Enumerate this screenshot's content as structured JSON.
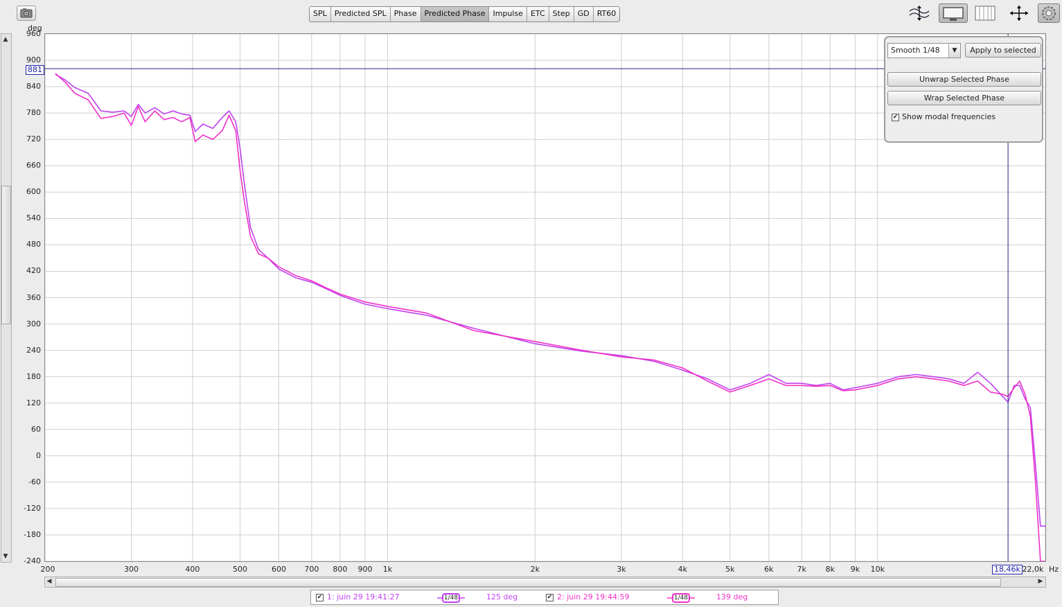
{
  "toolbar": {
    "tabs": [
      {
        "label": "SPL",
        "active": false
      },
      {
        "label": "Predicted SPL",
        "active": false
      },
      {
        "label": "Phase",
        "active": false
      },
      {
        "label": "Predicted Phase",
        "active": true
      },
      {
        "label": "Impulse",
        "active": false
      },
      {
        "label": "ETC",
        "active": false
      },
      {
        "label": "Step",
        "active": false
      },
      {
        "label": "GD",
        "active": false
      },
      {
        "label": "RT60",
        "active": false
      }
    ],
    "tools": [
      "vertical-zoom-icon",
      "limits-icon",
      "grid-lines-icon",
      "pan-icon",
      "settings-icon"
    ]
  },
  "panel": {
    "smoothing_value": "Smooth 1/48",
    "apply_label": "Apply to selected",
    "unwrap_label": "Unwrap Selected Phase",
    "wrap_label": "Wrap Selected Phase",
    "modal_label": "Show modal frequencies",
    "modal_checked": true
  },
  "cursor": {
    "y_value": "881",
    "x_value": "18,46k"
  },
  "legend": [
    {
      "checked": true,
      "name": "1: juin 29 19:41:27",
      "smoothing_num": "1",
      "smoothing_den": "48",
      "value": "125 deg",
      "color": "#c040f0"
    },
    {
      "checked": true,
      "name": "2: juin 29 19:44:59",
      "smoothing_num": "1",
      "smoothing_den": "48",
      "value": "139 deg",
      "color": "#f030c8"
    }
  ],
  "chart_data": {
    "type": "line",
    "y_unit": "deg",
    "x_unit": "Hz",
    "x_scale": "log",
    "xlim": [
      200,
      22000
    ],
    "ylim": [
      -240,
      960
    ],
    "x_ticks": [
      "200",
      "300",
      "400",
      "500",
      "600",
      "700",
      "800",
      "900",
      "1k",
      "2k",
      "3k",
      "4k",
      "5k",
      "6k",
      "7k",
      "8k",
      "9k",
      "10k",
      "22,0k"
    ],
    "y_ticks": [
      "960",
      "900",
      "840",
      "780",
      "720",
      "660",
      "600",
      "540",
      "480",
      "420",
      "360",
      "300",
      "240",
      "180",
      "120",
      "60",
      "0",
      "-60",
      "-120",
      "-180",
      "-240"
    ],
    "grid": true,
    "series": [
      {
        "name": "1: juin 29 19:41:27",
        "color": "#c040f0",
        "x": [
          210,
          220,
          230,
          245,
          260,
          275,
          290,
          300,
          310,
          320,
          335,
          350,
          365,
          380,
          395,
          405,
          420,
          440,
          460,
          475,
          490,
          500,
          510,
          525,
          545,
          570,
          600,
          650,
          700,
          750,
          800,
          900,
          1000,
          1200,
          1500,
          2000,
          2500,
          3000,
          3500,
          4000,
          4500,
          5000,
          5500,
          6000,
          6500,
          7000,
          7500,
          8000,
          8500,
          9000,
          10000,
          11000,
          12000,
          13000,
          14000,
          15000,
          16000,
          17000,
          18000,
          18460,
          19000,
          19500,
          20000,
          20500,
          21000,
          21500,
          22000
        ],
        "y": [
          868,
          855,
          838,
          825,
          785,
          782,
          785,
          772,
          800,
          780,
          792,
          778,
          785,
          778,
          775,
          738,
          755,
          745,
          770,
          785,
          760,
          700,
          620,
          520,
          470,
          450,
          425,
          405,
          395,
          380,
          365,
          345,
          335,
          320,
          290,
          255,
          238,
          228,
          215,
          195,
          175,
          150,
          165,
          185,
          165,
          165,
          160,
          165,
          150,
          155,
          165,
          180,
          185,
          180,
          175,
          165,
          190,
          165,
          135,
          122,
          160,
          160,
          130,
          110,
          -20,
          -160,
          -160
        ]
      },
      {
        "name": "2: juin 29 19:44:59",
        "color": "#f030c8",
        "x": [
          210,
          220,
          230,
          245,
          260,
          275,
          290,
          300,
          310,
          320,
          335,
          350,
          365,
          380,
          395,
          405,
          420,
          440,
          460,
          475,
          490,
          500,
          510,
          525,
          545,
          570,
          600,
          650,
          700,
          750,
          800,
          900,
          1000,
          1200,
          1500,
          2000,
          2500,
          3000,
          3500,
          4000,
          4500,
          5000,
          5500,
          6000,
          6500,
          7000,
          7500,
          8000,
          8500,
          9000,
          10000,
          11000,
          12000,
          13000,
          14000,
          15000,
          16000,
          17000,
          18000,
          18460,
          19000,
          19500,
          20000,
          20500,
          21000,
          21500,
          22000
        ],
        "y": [
          870,
          850,
          825,
          810,
          768,
          772,
          780,
          752,
          795,
          760,
          785,
          765,
          770,
          760,
          770,
          715,
          730,
          720,
          740,
          775,
          740,
          650,
          580,
          500,
          460,
          450,
          430,
          410,
          398,
          382,
          368,
          350,
          340,
          325,
          285,
          260,
          240,
          225,
          218,
          200,
          170,
          145,
          160,
          175,
          160,
          160,
          158,
          160,
          148,
          150,
          160,
          175,
          180,
          175,
          170,
          160,
          170,
          145,
          140,
          135,
          155,
          170,
          140,
          90,
          -60,
          -240,
          -240
        ]
      }
    ]
  }
}
